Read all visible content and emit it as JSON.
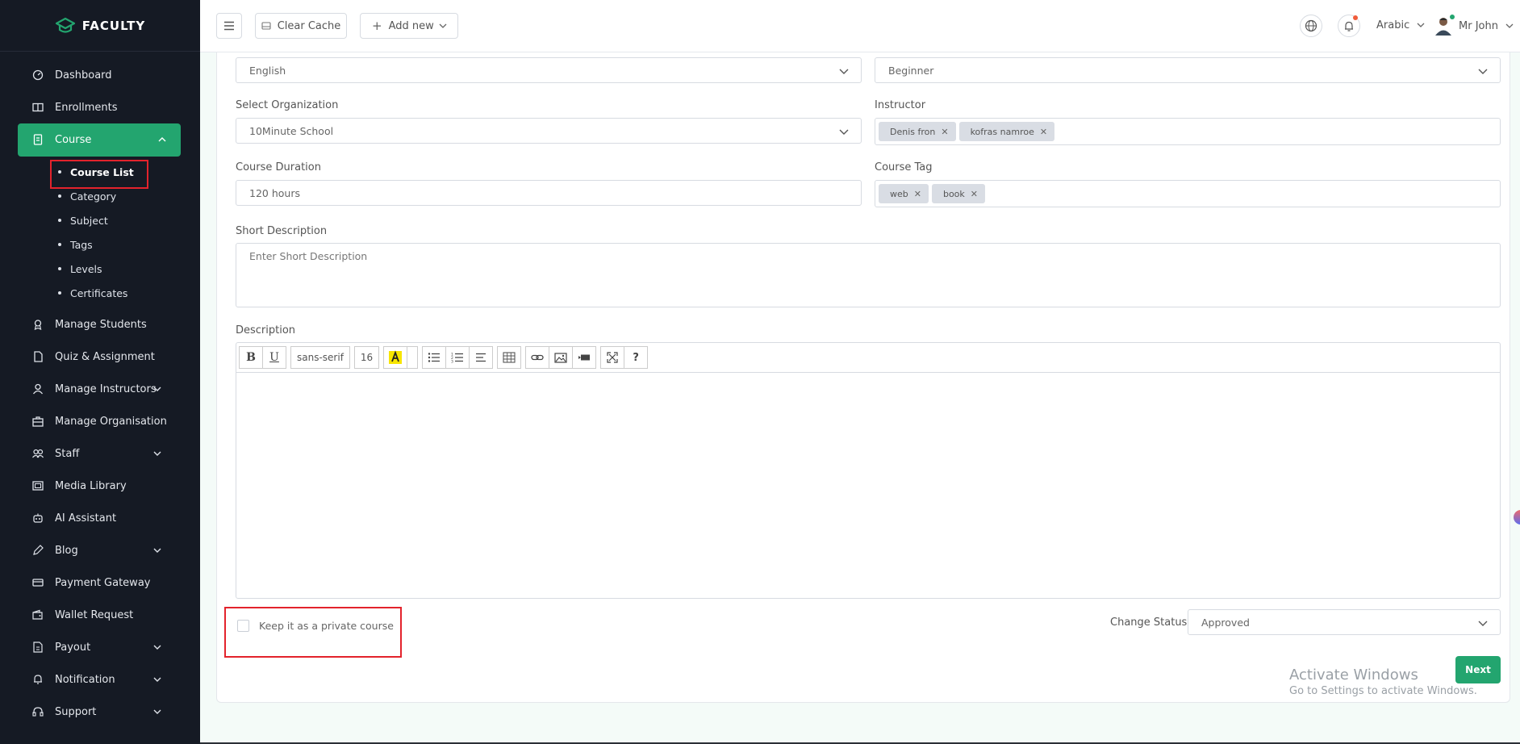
{
  "brand": {
    "name": "FACULTY"
  },
  "sidebar": {
    "items": [
      {
        "label": "Dashboard",
        "icon": "dashboard-icon"
      },
      {
        "label": "Enrollments",
        "icon": "book-icon"
      },
      {
        "label": "Course",
        "icon": "course-icon",
        "active": true,
        "expanded": true
      },
      {
        "label": "Manage Students",
        "icon": "student-icon"
      },
      {
        "label": "Quiz & Assignment",
        "icon": "quiz-icon"
      },
      {
        "label": "Manage Instructors",
        "icon": "instructor-icon",
        "has_children": true
      },
      {
        "label": "Manage Organisation",
        "icon": "organisation-icon"
      },
      {
        "label": "Staff",
        "icon": "staff-icon",
        "has_children": true
      },
      {
        "label": "Media Library",
        "icon": "media-icon"
      },
      {
        "label": "AI Assistant",
        "icon": "robot-icon"
      },
      {
        "label": "Blog",
        "icon": "blog-icon",
        "has_children": true
      },
      {
        "label": "Payment Gateway",
        "icon": "payment-icon"
      },
      {
        "label": "Wallet Request",
        "icon": "wallet-icon"
      },
      {
        "label": "Payout",
        "icon": "payout-icon",
        "has_children": true
      },
      {
        "label": "Notification",
        "icon": "bell-icon",
        "has_children": true
      },
      {
        "label": "Support",
        "icon": "headset-icon",
        "has_children": true
      }
    ],
    "course_sub": [
      {
        "label": "Course List",
        "current": true
      },
      {
        "label": "Category"
      },
      {
        "label": "Subject"
      },
      {
        "label": "Tags"
      },
      {
        "label": "Levels"
      },
      {
        "label": "Certificates"
      }
    ]
  },
  "topbar": {
    "clear_cache": "Clear Cache",
    "add_new": "Add new",
    "language": "Arabic",
    "user_name": "Mr John"
  },
  "form": {
    "language_value": "English",
    "level_value": "Beginner",
    "organization_label": "Select Organization",
    "organization_value": "10Minute School",
    "instructor_label": "Instructor",
    "instructors": [
      "Denis fron",
      "kofras namroe"
    ],
    "duration_label": "Course Duration",
    "duration_value": "120 hours",
    "tag_label": "Course Tag",
    "tags": [
      "web",
      "book"
    ],
    "short_desc_label": "Short Description",
    "short_desc_placeholder": "Enter Short Description",
    "description_label": "Description",
    "private_label": "Keep it as a private course",
    "status_label": "Change Status",
    "status_value": "Approved",
    "next": "Next"
  },
  "editor_toolbar": {
    "font_family": "sans-serif",
    "font_size": "16",
    "help": "?"
  },
  "overlay": {
    "activate_title": "Activate Windows",
    "activate_sub": "Go to Settings to activate Windows."
  },
  "colors": {
    "accent": "#23a56f",
    "sidebar_bg": "#151a24",
    "highlight": "#e3232c"
  }
}
